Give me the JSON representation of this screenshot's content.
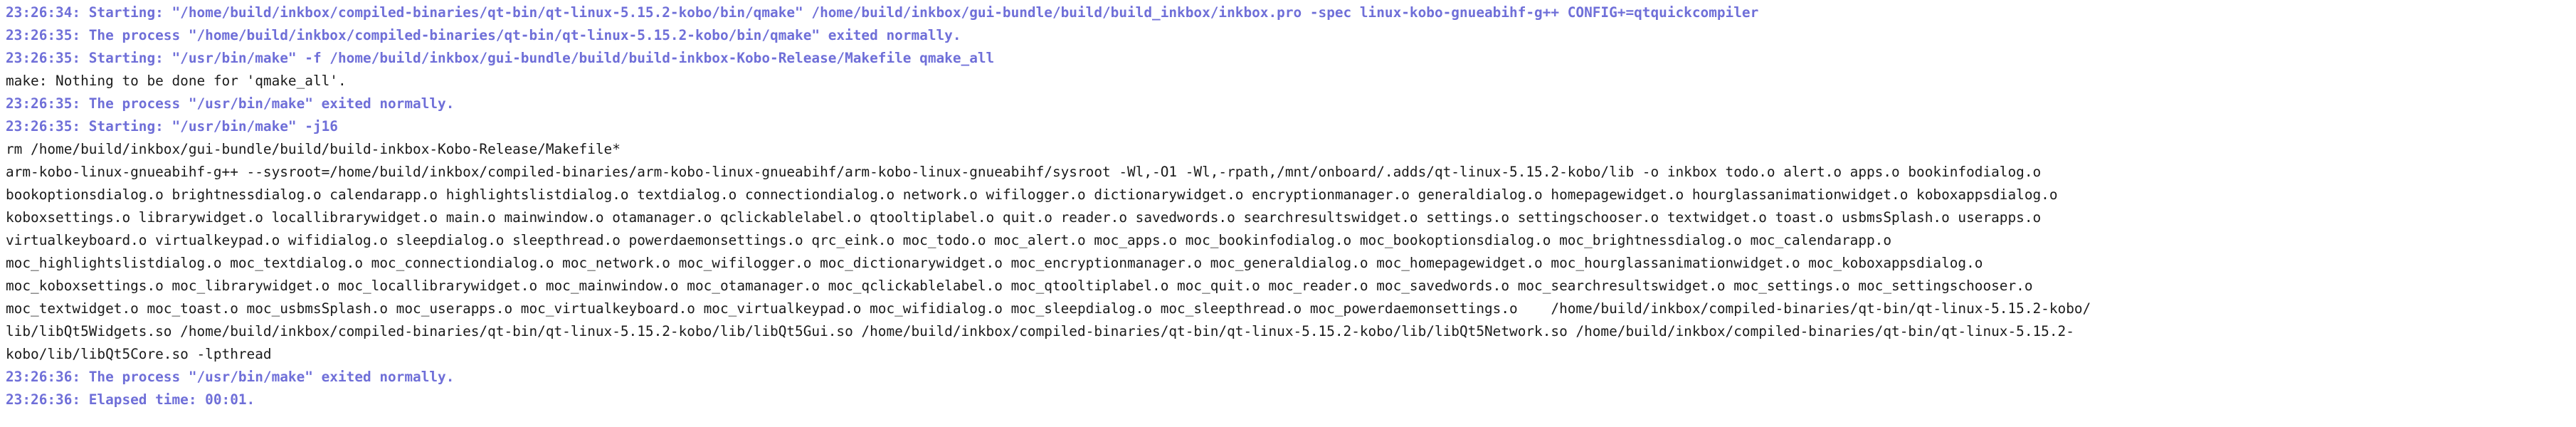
{
  "colors": {
    "background": "#ffffff",
    "status_text": "#6f6fd8",
    "output_text": "#1a1a1a"
  },
  "console": {
    "lines": [
      {
        "type": "status",
        "text": "23:26:34: Starting: \"/home/build/inkbox/compiled-binaries/qt-bin/qt-linux-5.15.2-kobo/bin/qmake\" /home/build/inkbox/gui-bundle/build/build_inkbox/inkbox.pro -spec linux-kobo-gnueabihf-g++ CONFIG+=qtquickcompiler"
      },
      {
        "type": "status",
        "text": "23:26:35: The process \"/home/build/inkbox/compiled-binaries/qt-bin/qt-linux-5.15.2-kobo/bin/qmake\" exited normally."
      },
      {
        "type": "status",
        "text": "23:26:35: Starting: \"/usr/bin/make\" -f /home/build/inkbox/gui-bundle/build/build-inkbox-Kobo-Release/Makefile qmake_all"
      },
      {
        "type": "output",
        "text": "make: Nothing to be done for 'qmake_all'."
      },
      {
        "type": "status",
        "text": "23:26:35: The process \"/usr/bin/make\" exited normally."
      },
      {
        "type": "status",
        "text": "23:26:35: Starting: \"/usr/bin/make\" -j16"
      },
      {
        "type": "output",
        "text": "rm /home/build/inkbox/gui-bundle/build/build-inkbox-Kobo-Release/Makefile*"
      },
      {
        "type": "output",
        "text": "arm-kobo-linux-gnueabihf-g++ --sysroot=/home/build/inkbox/compiled-binaries/arm-kobo-linux-gnueabihf/arm-kobo-linux-gnueabihf/sysroot -Wl,-O1 -Wl,-rpath,/mnt/onboard/.adds/qt-linux-5.15.2-kobo/lib -o inkbox todo.o alert.o apps.o bookinfodialog.o"
      },
      {
        "type": "output",
        "text": "bookoptionsdialog.o brightnessdialog.o calendarapp.o highlightslistdialog.o textdialog.o connectiondialog.o network.o wifilogger.o dictionarywidget.o encryptionmanager.o generaldialog.o homepagewidget.o hourglassanimationwidget.o koboxappsdialog.o"
      },
      {
        "type": "output",
        "text": "koboxsettings.o librarywidget.o locallibrarywidget.o main.o mainwindow.o otamanager.o qclickablelabel.o qtooltiplabel.o quit.o reader.o savedwords.o searchresultswidget.o settings.o settingschooser.o textwidget.o toast.o usbmsSplash.o userapps.o"
      },
      {
        "type": "output",
        "text": "virtualkeyboard.o virtualkeypad.o wifidialog.o sleepdialog.o sleepthread.o powerdaemonsettings.o qrc_eink.o moc_todo.o moc_alert.o moc_apps.o moc_bookinfodialog.o moc_bookoptionsdialog.o moc_brightnessdialog.o moc_calendarapp.o"
      },
      {
        "type": "output",
        "text": "moc_highlightslistdialog.o moc_textdialog.o moc_connectiondialog.o moc_network.o moc_wifilogger.o moc_dictionarywidget.o moc_encryptionmanager.o moc_generaldialog.o moc_homepagewidget.o moc_hourglassanimationwidget.o moc_koboxappsdialog.o"
      },
      {
        "type": "output",
        "text": "moc_koboxsettings.o moc_librarywidget.o moc_locallibrarywidget.o moc_mainwindow.o moc_otamanager.o moc_qclickablelabel.o moc_qtooltiplabel.o moc_quit.o moc_reader.o moc_savedwords.o moc_searchresultswidget.o moc_settings.o moc_settingschooser.o"
      },
      {
        "type": "output",
        "text": "moc_textwidget.o moc_toast.o moc_usbmsSplash.o moc_userapps.o moc_virtualkeyboard.o moc_virtualkeypad.o moc_wifidialog.o moc_sleepdialog.o moc_sleepthread.o moc_powerdaemonsettings.o    /home/build/inkbox/compiled-binaries/qt-bin/qt-linux-5.15.2-kobo/"
      },
      {
        "type": "output",
        "text": "lib/libQt5Widgets.so /home/build/inkbox/compiled-binaries/qt-bin/qt-linux-5.15.2-kobo/lib/libQt5Gui.so /home/build/inkbox/compiled-binaries/qt-bin/qt-linux-5.15.2-kobo/lib/libQt5Network.so /home/build/inkbox/compiled-binaries/qt-bin/qt-linux-5.15.2-"
      },
      {
        "type": "output",
        "text": "kobo/lib/libQt5Core.so -lpthread"
      },
      {
        "type": "status",
        "text": "23:26:36: The process \"/usr/bin/make\" exited normally."
      },
      {
        "type": "status",
        "text": "23:26:36: Elapsed time: 00:01."
      }
    ]
  }
}
